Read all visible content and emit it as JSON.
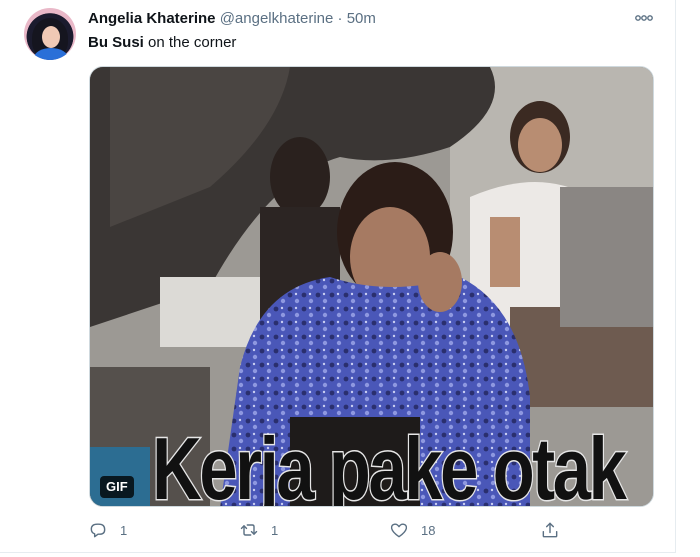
{
  "author": {
    "display_name": "Angelia Khaterine",
    "handle": "@angelkhaterine",
    "separator": "·",
    "time": "50m"
  },
  "tweet": {
    "text_bold": "Bu Susi",
    "text_rest": " on the corner"
  },
  "media": {
    "caption": "Kerja pake otak",
    "badge": "GIF"
  },
  "actions": {
    "reply_count": "1",
    "retweet_count": "1",
    "like_count": "18"
  },
  "icons": {
    "more": "more-icon",
    "reply": "reply-icon",
    "retweet": "retweet-icon",
    "like": "heart-icon",
    "share": "share-icon"
  },
  "colors": {
    "text": "#0f1419",
    "secondary": "#5b7083",
    "border": "#e6ecf0"
  }
}
